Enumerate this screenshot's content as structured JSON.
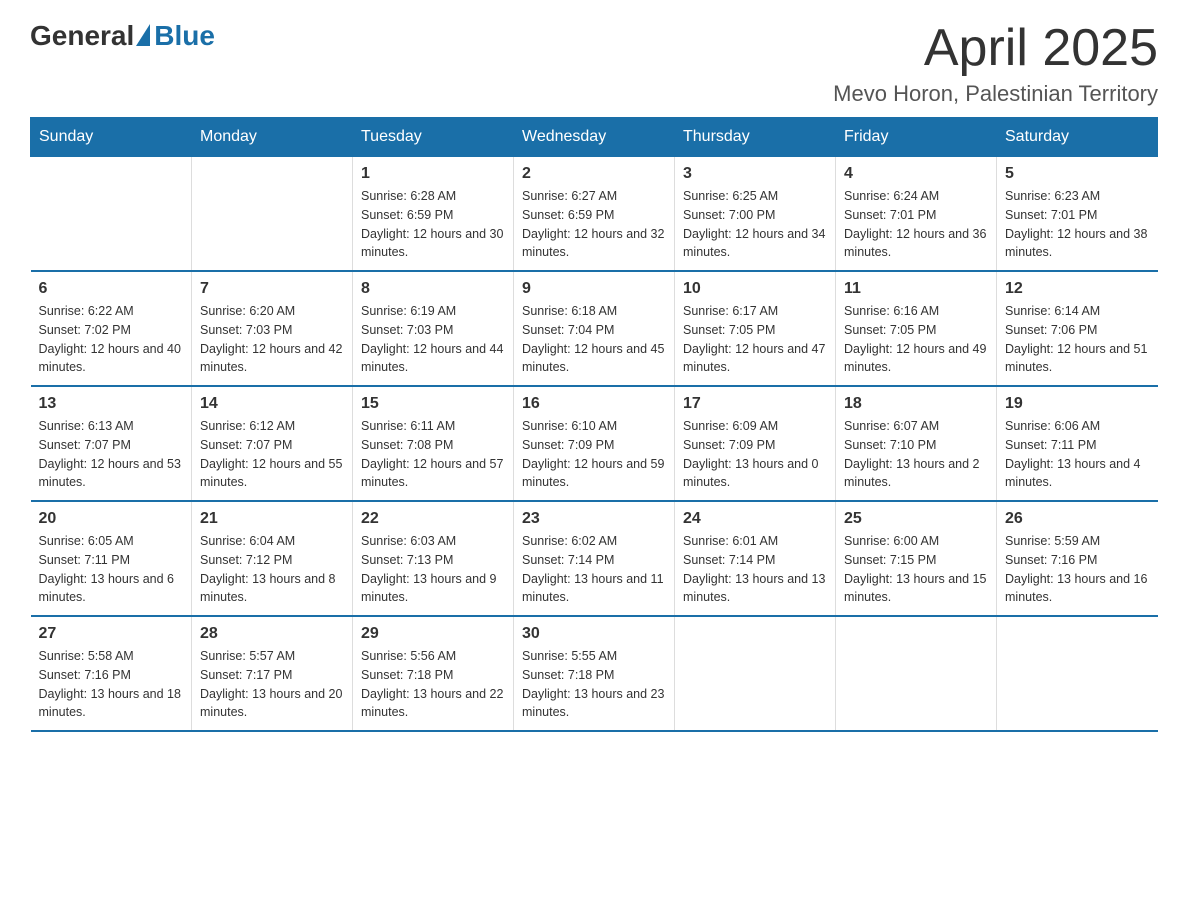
{
  "header": {
    "logo": {
      "general": "General",
      "blue": "Blue"
    },
    "title": "April 2025",
    "location": "Mevo Horon, Palestinian Territory"
  },
  "calendar": {
    "days_of_week": [
      "Sunday",
      "Monday",
      "Tuesday",
      "Wednesday",
      "Thursday",
      "Friday",
      "Saturday"
    ],
    "weeks": [
      [
        {
          "day": "",
          "info": ""
        },
        {
          "day": "",
          "info": ""
        },
        {
          "day": "1",
          "sunrise": "6:28 AM",
          "sunset": "6:59 PM",
          "daylight": "12 hours and 30 minutes."
        },
        {
          "day": "2",
          "sunrise": "6:27 AM",
          "sunset": "6:59 PM",
          "daylight": "12 hours and 32 minutes."
        },
        {
          "day": "3",
          "sunrise": "6:25 AM",
          "sunset": "7:00 PM",
          "daylight": "12 hours and 34 minutes."
        },
        {
          "day": "4",
          "sunrise": "6:24 AM",
          "sunset": "7:01 PM",
          "daylight": "12 hours and 36 minutes."
        },
        {
          "day": "5",
          "sunrise": "6:23 AM",
          "sunset": "7:01 PM",
          "daylight": "12 hours and 38 minutes."
        }
      ],
      [
        {
          "day": "6",
          "sunrise": "6:22 AM",
          "sunset": "7:02 PM",
          "daylight": "12 hours and 40 minutes."
        },
        {
          "day": "7",
          "sunrise": "6:20 AM",
          "sunset": "7:03 PM",
          "daylight": "12 hours and 42 minutes."
        },
        {
          "day": "8",
          "sunrise": "6:19 AM",
          "sunset": "7:03 PM",
          "daylight": "12 hours and 44 minutes."
        },
        {
          "day": "9",
          "sunrise": "6:18 AM",
          "sunset": "7:04 PM",
          "daylight": "12 hours and 45 minutes."
        },
        {
          "day": "10",
          "sunrise": "6:17 AM",
          "sunset": "7:05 PM",
          "daylight": "12 hours and 47 minutes."
        },
        {
          "day": "11",
          "sunrise": "6:16 AM",
          "sunset": "7:05 PM",
          "daylight": "12 hours and 49 minutes."
        },
        {
          "day": "12",
          "sunrise": "6:14 AM",
          "sunset": "7:06 PM",
          "daylight": "12 hours and 51 minutes."
        }
      ],
      [
        {
          "day": "13",
          "sunrise": "6:13 AM",
          "sunset": "7:07 PM",
          "daylight": "12 hours and 53 minutes."
        },
        {
          "day": "14",
          "sunrise": "6:12 AM",
          "sunset": "7:07 PM",
          "daylight": "12 hours and 55 minutes."
        },
        {
          "day": "15",
          "sunrise": "6:11 AM",
          "sunset": "7:08 PM",
          "daylight": "12 hours and 57 minutes."
        },
        {
          "day": "16",
          "sunrise": "6:10 AM",
          "sunset": "7:09 PM",
          "daylight": "12 hours and 59 minutes."
        },
        {
          "day": "17",
          "sunrise": "6:09 AM",
          "sunset": "7:09 PM",
          "daylight": "13 hours and 0 minutes."
        },
        {
          "day": "18",
          "sunrise": "6:07 AM",
          "sunset": "7:10 PM",
          "daylight": "13 hours and 2 minutes."
        },
        {
          "day": "19",
          "sunrise": "6:06 AM",
          "sunset": "7:11 PM",
          "daylight": "13 hours and 4 minutes."
        }
      ],
      [
        {
          "day": "20",
          "sunrise": "6:05 AM",
          "sunset": "7:11 PM",
          "daylight": "13 hours and 6 minutes."
        },
        {
          "day": "21",
          "sunrise": "6:04 AM",
          "sunset": "7:12 PM",
          "daylight": "13 hours and 8 minutes."
        },
        {
          "day": "22",
          "sunrise": "6:03 AM",
          "sunset": "7:13 PM",
          "daylight": "13 hours and 9 minutes."
        },
        {
          "day": "23",
          "sunrise": "6:02 AM",
          "sunset": "7:14 PM",
          "daylight": "13 hours and 11 minutes."
        },
        {
          "day": "24",
          "sunrise": "6:01 AM",
          "sunset": "7:14 PM",
          "daylight": "13 hours and 13 minutes."
        },
        {
          "day": "25",
          "sunrise": "6:00 AM",
          "sunset": "7:15 PM",
          "daylight": "13 hours and 15 minutes."
        },
        {
          "day": "26",
          "sunrise": "5:59 AM",
          "sunset": "7:16 PM",
          "daylight": "13 hours and 16 minutes."
        }
      ],
      [
        {
          "day": "27",
          "sunrise": "5:58 AM",
          "sunset": "7:16 PM",
          "daylight": "13 hours and 18 minutes."
        },
        {
          "day": "28",
          "sunrise": "5:57 AM",
          "sunset": "7:17 PM",
          "daylight": "13 hours and 20 minutes."
        },
        {
          "day": "29",
          "sunrise": "5:56 AM",
          "sunset": "7:18 PM",
          "daylight": "13 hours and 22 minutes."
        },
        {
          "day": "30",
          "sunrise": "5:55 AM",
          "sunset": "7:18 PM",
          "daylight": "13 hours and 23 minutes."
        },
        {
          "day": "",
          "info": ""
        },
        {
          "day": "",
          "info": ""
        },
        {
          "day": "",
          "info": ""
        }
      ]
    ]
  }
}
